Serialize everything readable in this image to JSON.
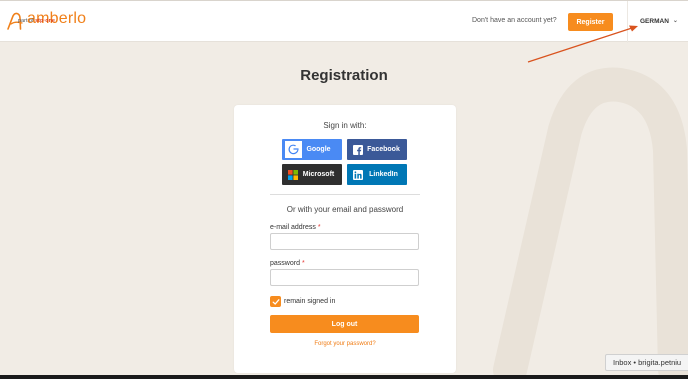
{
  "header": {
    "logo_text": "amberlo",
    "logo_sub_prefix": "part of",
    "logo_sub_brand": "stp·one",
    "no_account_text": "Don't have an account yet?",
    "register_label": "Register",
    "language": "GERMAN"
  },
  "main": {
    "title": "Registration",
    "sign_in_with": "Sign in with:",
    "social": {
      "google": "Google",
      "facebook": "Facebook",
      "microsoft": "Microsoft",
      "linkedin": "LinkedIn"
    },
    "or_text": "Or with your email and password",
    "email_label": "e-mail address",
    "password_label": "password",
    "required_mark": "*",
    "remain_signed_in": "remain signed in",
    "remain_checked": true,
    "login_label": "Log out",
    "forgot_label": "Forgot your password?"
  },
  "tooltip": {
    "text": "Inbox • brigita.petniu"
  },
  "colors": {
    "accent": "#f78c1e",
    "brand": "#f0801a",
    "google": "#4a8af4",
    "facebook": "#3b5998",
    "microsoft": "#2f2f2f",
    "linkedin": "#0077b5",
    "background": "#f1ece5",
    "annotation_arrow": "#d9531e"
  },
  "icons": [
    "amberlo-logo-icon",
    "chevron-down-icon",
    "google-icon",
    "facebook-icon",
    "microsoft-icon",
    "linkedin-icon",
    "check-icon"
  ]
}
